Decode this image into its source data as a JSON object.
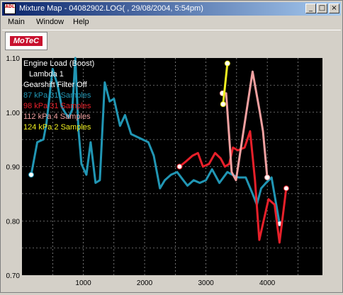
{
  "window": {
    "icon_label": "ADL",
    "title": "Mixture Map - 04082902.LOG( , 29/08/2004,  5:54pm)",
    "buttons": {
      "minimize": "_",
      "maximize": "□",
      "close": "×"
    }
  },
  "menu": [
    {
      "label": "Main"
    },
    {
      "label": "Window"
    },
    {
      "label": "Help"
    }
  ],
  "toolbar": {
    "logo_text": "MoTeC"
  },
  "chart_data": {
    "type": "line",
    "title": "Engine Load (Boost)",
    "info_lines": [
      "Engine Load (Boost)",
      "Lambda 1",
      "Gearshift Filter Off"
    ],
    "xlim": [
      0,
      4900
    ],
    "ylim": [
      0.7,
      1.1
    ],
    "x_ticks": [
      1000,
      2000,
      3000,
      4000
    ],
    "y_ticks": [
      0.7,
      0.8,
      0.9,
      1.0,
      1.1
    ],
    "y_tick_labels": [
      "0.70",
      "0.80",
      "0.90",
      "1.00",
      "1.10"
    ],
    "grid": true,
    "series": [
      {
        "name": "87 kPa 31 Samples",
        "color": "#2196b4",
        "points": [
          [
            150,
            0.885
          ],
          [
            250,
            0.945
          ],
          [
            350,
            0.95
          ],
          [
            400,
            0.98
          ],
          [
            500,
            1.08
          ],
          [
            580,
            1.05
          ],
          [
            650,
            1.01
          ],
          [
            700,
            1.0
          ],
          [
            760,
            0.99
          ],
          [
            820,
            1.005
          ],
          [
            870,
            1.1
          ],
          [
            920,
            0.97
          ],
          [
            970,
            0.905
          ],
          [
            1050,
            0.885
          ],
          [
            1120,
            0.945
          ],
          [
            1200,
            0.87
          ],
          [
            1270,
            0.875
          ],
          [
            1350,
            1.055
          ],
          [
            1430,
            1.02
          ],
          [
            1500,
            1.025
          ],
          [
            1600,
            0.975
          ],
          [
            1680,
            0.995
          ],
          [
            1780,
            0.96
          ],
          [
            2060,
            0.945
          ],
          [
            2150,
            0.92
          ],
          [
            2250,
            0.86
          ],
          [
            2330,
            0.875
          ],
          [
            2430,
            0.885
          ],
          [
            2530,
            0.89
          ],
          [
            2630,
            0.875
          ],
          [
            2700,
            0.865
          ],
          [
            2800,
            0.875
          ],
          [
            2900,
            0.87
          ],
          [
            3000,
            0.875
          ],
          [
            3100,
            0.895
          ],
          [
            3220,
            0.87
          ],
          [
            3350,
            0.89
          ],
          [
            3430,
            0.885
          ],
          [
            3530,
            0.88
          ],
          [
            3650,
            0.88
          ],
          [
            3760,
            0.85
          ],
          [
            3830,
            0.83
          ],
          [
            3900,
            0.86
          ],
          [
            3980,
            0.87
          ],
          [
            4070,
            0.88
          ],
          [
            4200,
            0.795
          ]
        ]
      },
      {
        "name": "98 kPa 31 Samples",
        "color": "#e8202a",
        "points": [
          [
            2570,
            0.9
          ],
          [
            2680,
            0.91
          ],
          [
            2780,
            0.92
          ],
          [
            2870,
            0.925
          ],
          [
            2950,
            0.9
          ],
          [
            3050,
            0.905
          ],
          [
            3150,
            0.925
          ],
          [
            3240,
            0.915
          ],
          [
            3310,
            0.9
          ],
          [
            3380,
            0.905
          ],
          [
            3440,
            0.935
          ],
          [
            3520,
            0.93
          ],
          [
            3630,
            0.935
          ],
          [
            3720,
            0.965
          ],
          [
            3800,
            0.875
          ],
          [
            3870,
            0.765
          ],
          [
            4020,
            0.84
          ],
          [
            4120,
            0.83
          ],
          [
            4200,
            0.76
          ],
          [
            4310,
            0.86
          ]
        ]
      },
      {
        "name": "112 kPa 4 Samples",
        "color": "#f0a0a0",
        "points": [
          [
            3270,
            1.035
          ],
          [
            3330,
            1.035
          ],
          [
            3420,
            0.89
          ],
          [
            3490,
            0.875
          ],
          [
            3760,
            1.075
          ],
          [
            3880,
            1.0
          ],
          [
            3930,
            0.965
          ],
          [
            4000,
            0.88
          ]
        ]
      },
      {
        "name": "124 kPa 2 Samples",
        "color": "#f0f020",
        "points": [
          [
            3280,
            1.015
          ],
          [
            3350,
            1.09
          ]
        ]
      }
    ]
  }
}
